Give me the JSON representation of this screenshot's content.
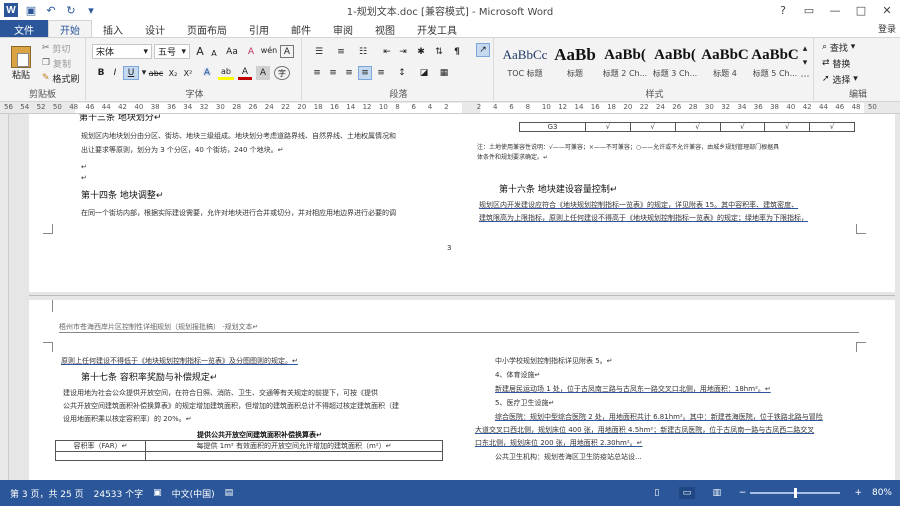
{
  "window": {
    "title": "1-规划文本.doc [兼容模式] - Microsoft Word",
    "controls": [
      "?",
      "▭",
      "—",
      "□",
      "✕"
    ]
  },
  "tabs": [
    "文件",
    "开始",
    "插入",
    "设计",
    "页面布局",
    "引用",
    "邮件",
    "审阅",
    "视图",
    "开发工具"
  ],
  "active_tab": "开始",
  "login": "登录",
  "clipboard": {
    "paste": "粘贴",
    "cut": "剪切",
    "copy": "复制",
    "format_painter": "格式刷",
    "label": "剪贴板"
  },
  "font": {
    "name": "宋体",
    "size": "五号",
    "label": "字体",
    "grow": "A",
    "shrink": "A",
    "case": "Aa",
    "clear": "A",
    "phonetic": "wén",
    "border": "A",
    "bold": "B",
    "italic": "I",
    "underline": "U",
    "strike": "abc",
    "sub": "X₂",
    "sup": "X²",
    "effects": "A",
    "highlight": "ab",
    "color": "A",
    "shading": "A",
    "enclose": "字"
  },
  "paragraph": {
    "label": "段落"
  },
  "styles": {
    "label": "样式",
    "items": [
      {
        "preview": "AaBbCc",
        "name": "TOC 标题"
      },
      {
        "preview": "AaBb",
        "name": "标题"
      },
      {
        "preview": "AaBb(",
        "name": "标题 2 Ch..."
      },
      {
        "preview": "AaBb(",
        "name": "标题 3 Ch..."
      },
      {
        "preview": "AaBbC",
        "name": "标题 4"
      },
      {
        "preview": "AaBbC",
        "name": "标题 5 Ch..."
      }
    ]
  },
  "editing": {
    "find": "查找",
    "replace": "替换",
    "select": "选择",
    "label": "编辑"
  },
  "ruler_ticks": [
    "56",
    "54",
    "52",
    "50",
    "48",
    "46",
    "44",
    "42",
    "40",
    "38",
    "36",
    "34",
    "32",
    "30",
    "28",
    "26",
    "24",
    "22",
    "20",
    "18",
    "16",
    "14",
    "12",
    "10",
    "8",
    "6",
    "4",
    "2",
    "",
    "2",
    "4",
    "6",
    "8",
    "10",
    "12",
    "14",
    "16",
    "18",
    "20",
    "22",
    "24",
    "26",
    "28",
    "30",
    "32",
    "34",
    "36",
    "38",
    "40",
    "42",
    "44",
    "46",
    "48",
    "50"
  ],
  "page1": {
    "left_top_heading": "第十三条  地块划分↵",
    "left_lines": [
      "规划区内地块划分由分区、街坊、地块三级组成。地块划分考虑道路界线、自然界线、土地权属情况和",
      "出让要求等原则，划分为 3 个分区，40 个街坊，240 个地块。↵"
    ],
    "left_heading2": "第十四条  地块调整↵",
    "left_lines2": [
      "在同一个街坊内部，根据实际建设需要，允许对地块进行合并或切分，并对相应用地边界进行必要的调"
    ],
    "table_row": [
      "G3",
      "√",
      "√",
      "√",
      "√",
      "√",
      "√"
    ],
    "right_note": [
      "注：土地使用兼容性说明：√——可兼容；×——不可兼容；○——允许或不允许兼容，由城乡规划管理部门根据具",
      "体条件和规划要求确定。↵"
    ],
    "right_heading": "第十六条  地块建设容量控制↵",
    "right_lines": [
      "规划区内开发建设应符合《地块规划控制指标一览表》的规定，详见附表 15。其中容积率、建筑密度、",
      "建筑限高为上限指标，原则上任何建设不得高于《地块规划控制指标一览表》的规定；绿地率为下限指标，"
    ],
    "page_number": "3"
  },
  "page2": {
    "header": "梧州市苍海西岸片区控制性详细规划（规划报批稿）  ·规划文本↵",
    "left_line1": "原则上任何建设不得低于《地块规划控制指标一览表》及分图图则的规定。↵",
    "left_heading": "第十七条  容积率奖励与补偿规定↵",
    "left_lines": [
      "建设用地为社会公众提供开放空间，在符合日照、消防、卫生、交通等有关规定的前提下，可按《提供",
      "公共开放空间建筑面积补偿换算表》的规定增加建筑面积，但增加的建筑面积总计不得超过核定建筑面积（建",
      "设用地面积乘以核定容积率）的 20%。↵"
    ],
    "table_title": "提供公共开放空间建筑面积补偿换算表↵",
    "table_header": [
      "容积率（FAR）↵",
      "每提供 1m² 有效面积的开放空间允许增加的建筑面积（m²）↵"
    ],
    "right_lines": [
      "中小学校规划控制指标详见附表 5。↵",
      "4、体育设施↵",
      "新建居民运动场 1 处，位于古凤南三路与古凤东一路交叉口北侧，用地面积：18hm²。↵",
      "5、医疗卫生设施↵",
      "综合医院：规划中型综合医院 2 处，用地面积共计 6.81hm²。其中：新建苍海医院，位于铁路北路与冒险",
      "大道交叉口西北侧，规划床位 400 张，用地面积 4.5hm²；新建古凤医院，位于古凤南一路与古凤西二路交叉",
      "口东北侧，规划床位 200 张，用地面积 2.30hm²。↵",
      "公共卫生机构：规划苍海区卫生防疫站总站设..."
    ]
  },
  "status": {
    "page": "第 3 页，共 25 页",
    "words": "24533 个字",
    "lang": "中文(中国)",
    "zoom": "80%"
  }
}
